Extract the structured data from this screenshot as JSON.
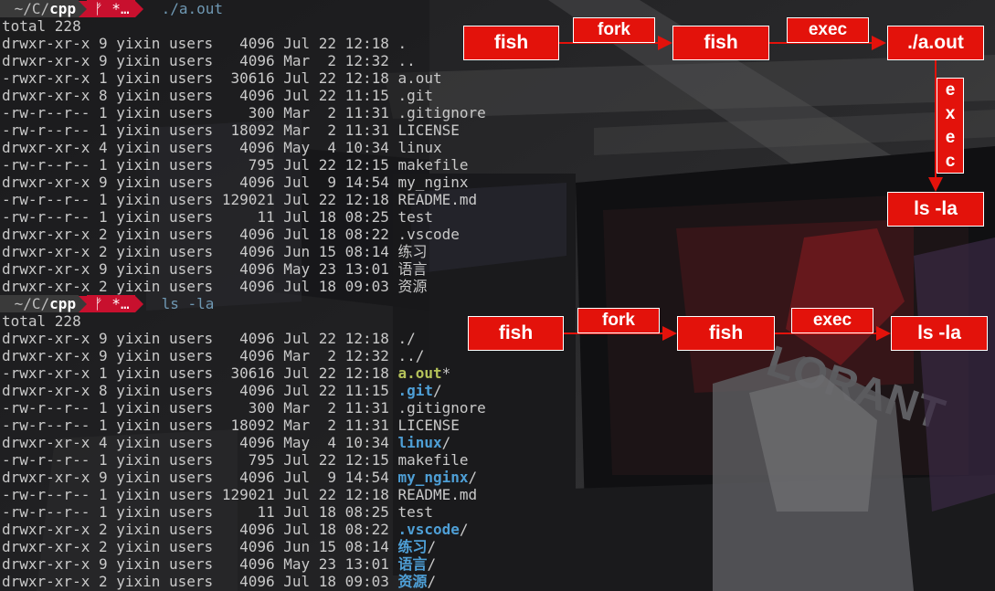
{
  "terminal": {
    "prompt1": {
      "path_prefix": " ~/C/",
      "path_dir": "cpp",
      "git": "ᚠ *…",
      "command": "./a.out"
    },
    "block1": {
      "total": "total 228",
      "rows": [
        {
          "text": "drwxr-xr-x 9 yixin users   4096 Jul 22 12:18 ",
          "name": "."
        },
        {
          "text": "drwxr-xr-x 9 yixin users   4096 Mar  2 12:32 ",
          "name": ".."
        },
        {
          "text": "-rwxr-xr-x 1 yixin users  30616 Jul 22 12:18 ",
          "name": "a.out"
        },
        {
          "text": "drwxr-xr-x 8 yixin users   4096 Jul 22 11:15 ",
          "name": ".git"
        },
        {
          "text": "-rw-r--r-- 1 yixin users    300 Mar  2 11:31 ",
          "name": ".gitignore"
        },
        {
          "text": "-rw-r--r-- 1 yixin users  18092 Mar  2 11:31 ",
          "name": "LICENSE"
        },
        {
          "text": "drwxr-xr-x 4 yixin users   4096 May  4 10:34 ",
          "name": "linux"
        },
        {
          "text": "-rw-r--r-- 1 yixin users    795 Jul 22 12:15 ",
          "name": "makefile"
        },
        {
          "text": "drwxr-xr-x 9 yixin users   4096 Jul  9 14:54 ",
          "name": "my_nginx"
        },
        {
          "text": "-rw-r--r-- 1 yixin users 129021 Jul 22 12:18 ",
          "name": "README.md"
        },
        {
          "text": "-rw-r--r-- 1 yixin users     11 Jul 18 08:25 ",
          "name": "test"
        },
        {
          "text": "drwxr-xr-x 2 yixin users   4096 Jul 18 08:22 ",
          "name": ".vscode"
        },
        {
          "text": "drwxr-xr-x 2 yixin users   4096 Jun 15 08:14 ",
          "name": "练习"
        },
        {
          "text": "drwxr-xr-x 9 yixin users   4096 May 23 13:01 ",
          "name": "语言"
        },
        {
          "text": "drwxr-xr-x 2 yixin users   4096 Jul 18 09:03 ",
          "name": "资源"
        }
      ]
    },
    "prompt2": {
      "path_prefix": " ~/C/",
      "path_dir": "cpp",
      "git": "ᚠ *…",
      "command": "ls -la"
    },
    "block2": {
      "total": "total 228",
      "rows": [
        {
          "text": "drwxr-xr-x 9 yixin users   4096 Jul 22 12:18 ",
          "name": "./",
          "kind": "plain"
        },
        {
          "text": "drwxr-xr-x 9 yixin users   4096 Mar  2 12:32 ",
          "name": "../",
          "kind": "plain"
        },
        {
          "text": "-rwxr-xr-x 1 yixin users  30616 Jul 22 12:18 ",
          "name": "a.out",
          "suffix": "*",
          "kind": "exe"
        },
        {
          "text": "drwxr-xr-x 8 yixin users   4096 Jul 22 11:15 ",
          "name": ".git",
          "suffix": "/",
          "kind": "dir"
        },
        {
          "text": "-rw-r--r-- 1 yixin users    300 Mar  2 11:31 ",
          "name": ".gitignore",
          "kind": "plain"
        },
        {
          "text": "-rw-r--r-- 1 yixin users  18092 Mar  2 11:31 ",
          "name": "LICENSE",
          "kind": "plain"
        },
        {
          "text": "drwxr-xr-x 4 yixin users   4096 May  4 10:34 ",
          "name": "linux",
          "suffix": "/",
          "kind": "dir"
        },
        {
          "text": "-rw-r--r-- 1 yixin users    795 Jul 22 12:15 ",
          "name": "makefile",
          "kind": "plain"
        },
        {
          "text": "drwxr-xr-x 9 yixin users   4096 Jul  9 14:54 ",
          "name": "my_nginx",
          "suffix": "/",
          "kind": "dir"
        },
        {
          "text": "-rw-r--r-- 1 yixin users 129021 Jul 22 12:18 ",
          "name": "README.md",
          "kind": "plain"
        },
        {
          "text": "-rw-r--r-- 1 yixin users     11 Jul 18 08:25 ",
          "name": "test",
          "kind": "plain"
        },
        {
          "text": "drwxr-xr-x 2 yixin users   4096 Jul 18 08:22 ",
          "name": ".vscode",
          "suffix": "/",
          "kind": "dir"
        },
        {
          "text": "drwxr-xr-x 2 yixin users   4096 Jun 15 08:14 ",
          "name": "练习",
          "suffix": "/",
          "kind": "dir"
        },
        {
          "text": "drwxr-xr-x 9 yixin users   4096 May 23 13:01 ",
          "name": "语言",
          "suffix": "/",
          "kind": "dir"
        },
        {
          "text": "drwxr-xr-x 2 yixin users   4096 Jul 18 09:03 ",
          "name": "资源",
          "suffix": "/",
          "kind": "dir"
        }
      ]
    }
  },
  "diagram": {
    "top": {
      "fish1": "fish",
      "fork": "fork",
      "fish2": "fish",
      "exec": "exec",
      "aout": "./a.out",
      "exec_vertical": [
        "e",
        "x",
        "e",
        "c"
      ],
      "lsla": "ls -la"
    },
    "bottom": {
      "fish1": "fish",
      "fork": "fork",
      "fish2": "fish",
      "exec": "exec",
      "lsla": "ls -la"
    }
  },
  "colors": {
    "box_fill": "#e3120b",
    "prompt_red": "#c8102e",
    "dir": "#4e9fd6",
    "exe": "#b5c35a"
  }
}
